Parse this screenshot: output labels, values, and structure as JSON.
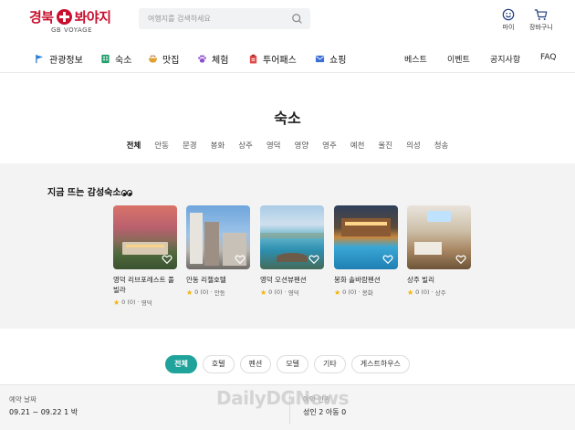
{
  "header": {
    "logo_main_left": "경북",
    "logo_main_right": "봐야지",
    "logo_sub": "GB VOYAGE",
    "search_placeholder": "여행지를 검색하세요",
    "my_label": "마이",
    "cart_label": "장바구니"
  },
  "nav": {
    "items": [
      {
        "label": "관광정보",
        "icon": "flag-icon",
        "color": "#2b7fd6"
      },
      {
        "label": "숙소",
        "icon": "building-icon",
        "color": "#22a06b"
      },
      {
        "label": "맛집",
        "icon": "bowl-icon",
        "color": "#e0a130"
      },
      {
        "label": "체험",
        "icon": "paw-icon",
        "color": "#8e4fd0"
      },
      {
        "label": "투어패스",
        "icon": "ticket-icon",
        "color": "#e04b4b"
      },
      {
        "label": "쇼핑",
        "icon": "mail-icon",
        "color": "#3a6fd8"
      }
    ],
    "right": [
      "베스트",
      "이벤트",
      "공지사항",
      "FAQ"
    ]
  },
  "page_title": "숙소",
  "regions": [
    "전체",
    "안동",
    "문경",
    "봉화",
    "상주",
    "영덕",
    "영양",
    "영주",
    "예천",
    "울진",
    "의성",
    "청송"
  ],
  "active_region": "전체",
  "trending": {
    "title": "지금 뜨는 감성숙소",
    "cards": [
      {
        "name": "영덕 리브포레스트 풀빌라",
        "rating": "0 (0)",
        "region": "영덕"
      },
      {
        "name": "안동 리첼호텔",
        "rating": "0 (0)",
        "region": "안동"
      },
      {
        "name": "영덕 오션뷰펜션",
        "rating": "0 (0)",
        "region": "영덕"
      },
      {
        "name": "봉화 솔바람펜션",
        "rating": "0 (0)",
        "region": "봉화"
      },
      {
        "name": "상주 빌리",
        "rating": "0 (0)",
        "region": "상주"
      }
    ]
  },
  "filters": [
    "전체",
    "호텔",
    "펜션",
    "모텔",
    "기타",
    "게스트하우스"
  ],
  "active_filter": "전체",
  "booking": {
    "date_label": "예약 날짜",
    "date_value": "09.21 ~ 09.22 1 박",
    "people_label": "예약 인원",
    "people_value": "성인 2 아동 0"
  },
  "watermark": "DailyDGNews",
  "colors": {
    "brand": "#c8102e",
    "accent": "#1fa39a",
    "star": "#f5b301"
  }
}
